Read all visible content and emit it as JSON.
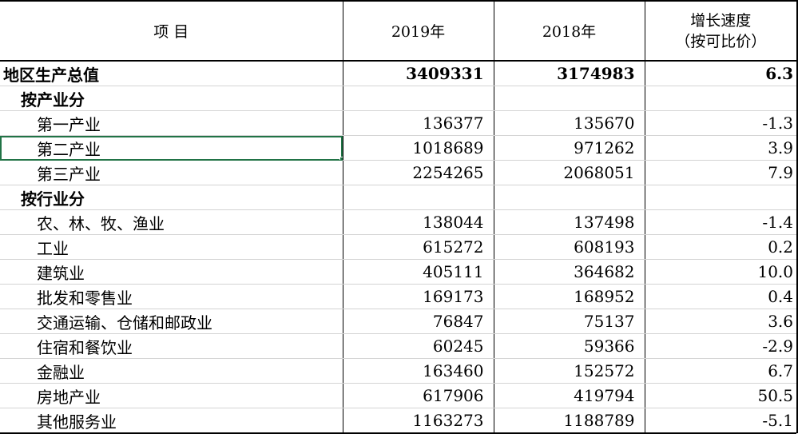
{
  "header": {
    "item": "项 目",
    "year1": "2019年",
    "year2": "2018年",
    "growth_line1": "增长速度",
    "growth_line2": "（按可比价）"
  },
  "rows": [
    {
      "label": "地区生产总值",
      "v2019": "3409331",
      "v2018": "3174983",
      "growth": "6.3",
      "level": 0
    },
    {
      "label": "按产业分",
      "v2019": "",
      "v2018": "",
      "growth": "",
      "level": 1
    },
    {
      "label": "第一产业",
      "v2019": "136377",
      "v2018": "135670",
      "growth": "-1.3",
      "level": 2
    },
    {
      "label": "第二产业",
      "v2019": "1018689",
      "v2018": "971262",
      "growth": "3.9",
      "level": 2
    },
    {
      "label": "第三产业",
      "v2019": "2254265",
      "v2018": "2068051",
      "growth": "7.9",
      "level": 2
    },
    {
      "label": "按行业分",
      "v2019": "",
      "v2018": "",
      "growth": "",
      "level": 1
    },
    {
      "label": "农、林、牧、渔业",
      "v2019": "138044",
      "v2018": "137498",
      "growth": "-1.4",
      "level": 2
    },
    {
      "label": "工业",
      "v2019": "615272",
      "v2018": "608193",
      "growth": "0.2",
      "level": 2
    },
    {
      "label": "建筑业",
      "v2019": "405111",
      "v2018": "364682",
      "growth": "10.0",
      "level": 2
    },
    {
      "label": "批发和零售业",
      "v2019": "169173",
      "v2018": "168952",
      "growth": "0.4",
      "level": 2
    },
    {
      "label": "交通运输、仓储和邮政业",
      "v2019": "76847",
      "v2018": "75137",
      "growth": "3.6",
      "level": 2
    },
    {
      "label": "住宿和餐饮业",
      "v2019": "60245",
      "v2018": "59366",
      "growth": "-2.9",
      "level": 2
    },
    {
      "label": "金融业",
      "v2019": "163460",
      "v2018": "152572",
      "growth": "6.7",
      "level": 2
    },
    {
      "label": "房地产业",
      "v2019": "617906",
      "v2018": "419794",
      "growth": "50.5",
      "level": 2
    },
    {
      "label": "其他服务业",
      "v2019": "1163273",
      "v2018": "1188789",
      "growth": "-5.1",
      "level": 2
    }
  ],
  "selection": {
    "accent": "#217346"
  }
}
